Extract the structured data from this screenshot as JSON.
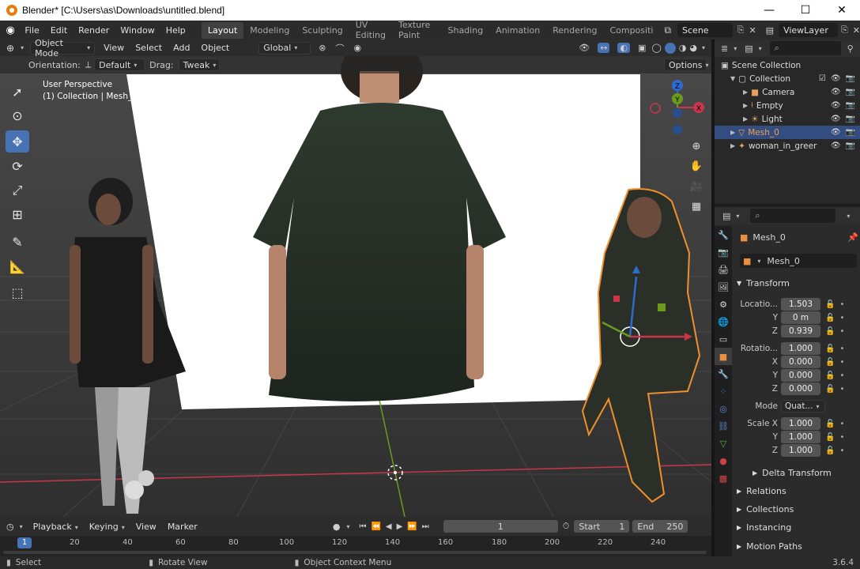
{
  "window": {
    "title": "Blender* [C:\\Users\\as\\Downloads\\untitled.blend]",
    "minimize": "—",
    "maximize": "☐",
    "close": "✕"
  },
  "menubar": {
    "items": [
      "File",
      "Edit",
      "Render",
      "Window",
      "Help"
    ],
    "workspaces": [
      "Layout",
      "Modeling",
      "Sculpting",
      "UV Editing",
      "Texture Paint",
      "Shading",
      "Animation",
      "Rendering",
      "Compositi"
    ],
    "active_workspace": "Layout",
    "scene": "Scene",
    "view_layer": "ViewLayer"
  },
  "viewport": {
    "mode": "Object Mode",
    "menus": [
      "View",
      "Select",
      "Add",
      "Object"
    ],
    "transform_orientation": "Global",
    "orientation_label": "Orientation:",
    "orientation_value": "Default",
    "drag_label": "Drag:",
    "drag_value": "Tweak",
    "options": "Options",
    "overlay_title": "User Perspective",
    "overlay_collection": "(1) Collection | Mesh_0",
    "gizmo_z": "Z",
    "gizmo_y": "Y",
    "gizmo_x": "X"
  },
  "outliner": {
    "root": "Scene Collection",
    "items": [
      {
        "name": "Collection",
        "icon": "collection-icon"
      },
      {
        "name": "Camera",
        "icon": "camera-icon"
      },
      {
        "name": "Empty",
        "icon": "empty-icon"
      },
      {
        "name": "Light",
        "icon": "light-icon"
      },
      {
        "name": "Mesh_0",
        "icon": "mesh-icon"
      },
      {
        "name": "woman_in_greer",
        "icon": "armature-icon"
      }
    ]
  },
  "properties": {
    "object_name": "Mesh_0",
    "data_name": "Mesh_0",
    "transform_title": "Transform",
    "location": {
      "label": "Locatio...",
      "x": "1.503",
      "y": "0 m",
      "z": "0.939"
    },
    "rotation": {
      "label": "Rotatio...",
      "w": "1.000",
      "x": "0.000",
      "y": "0.000",
      "z": "0.000"
    },
    "mode_label": "Mode",
    "mode_value": "Quat...",
    "scale": {
      "label": "Scale X",
      "x": "1.000",
      "y": "1.000",
      "z": "1.000"
    },
    "axis_labels": {
      "x": "X",
      "y": "Y",
      "z": "Z"
    },
    "panels": [
      "Delta Transform",
      "Relations",
      "Collections",
      "Instancing",
      "Motion Paths"
    ]
  },
  "timeline": {
    "menus": [
      "Playback",
      "Keying",
      "View",
      "Marker"
    ],
    "current_frame": "1",
    "start_label": "Start",
    "start": "1",
    "end_label": "End",
    "end": "250",
    "ruler": [
      "1",
      "20",
      "40",
      "60",
      "80",
      "100",
      "120",
      "140",
      "160",
      "180",
      "200",
      "220",
      "240"
    ]
  },
  "statusbar": {
    "select": "Select",
    "rotate": "Rotate View",
    "context": "Object Context Menu",
    "version": "3.6.4"
  },
  "colors": {
    "accent": "#4772b3",
    "selection_outline": "#f0902c",
    "x_axis": "#c9364a",
    "y_axis": "#6b9a1f",
    "z_axis": "#2f6ad1"
  }
}
